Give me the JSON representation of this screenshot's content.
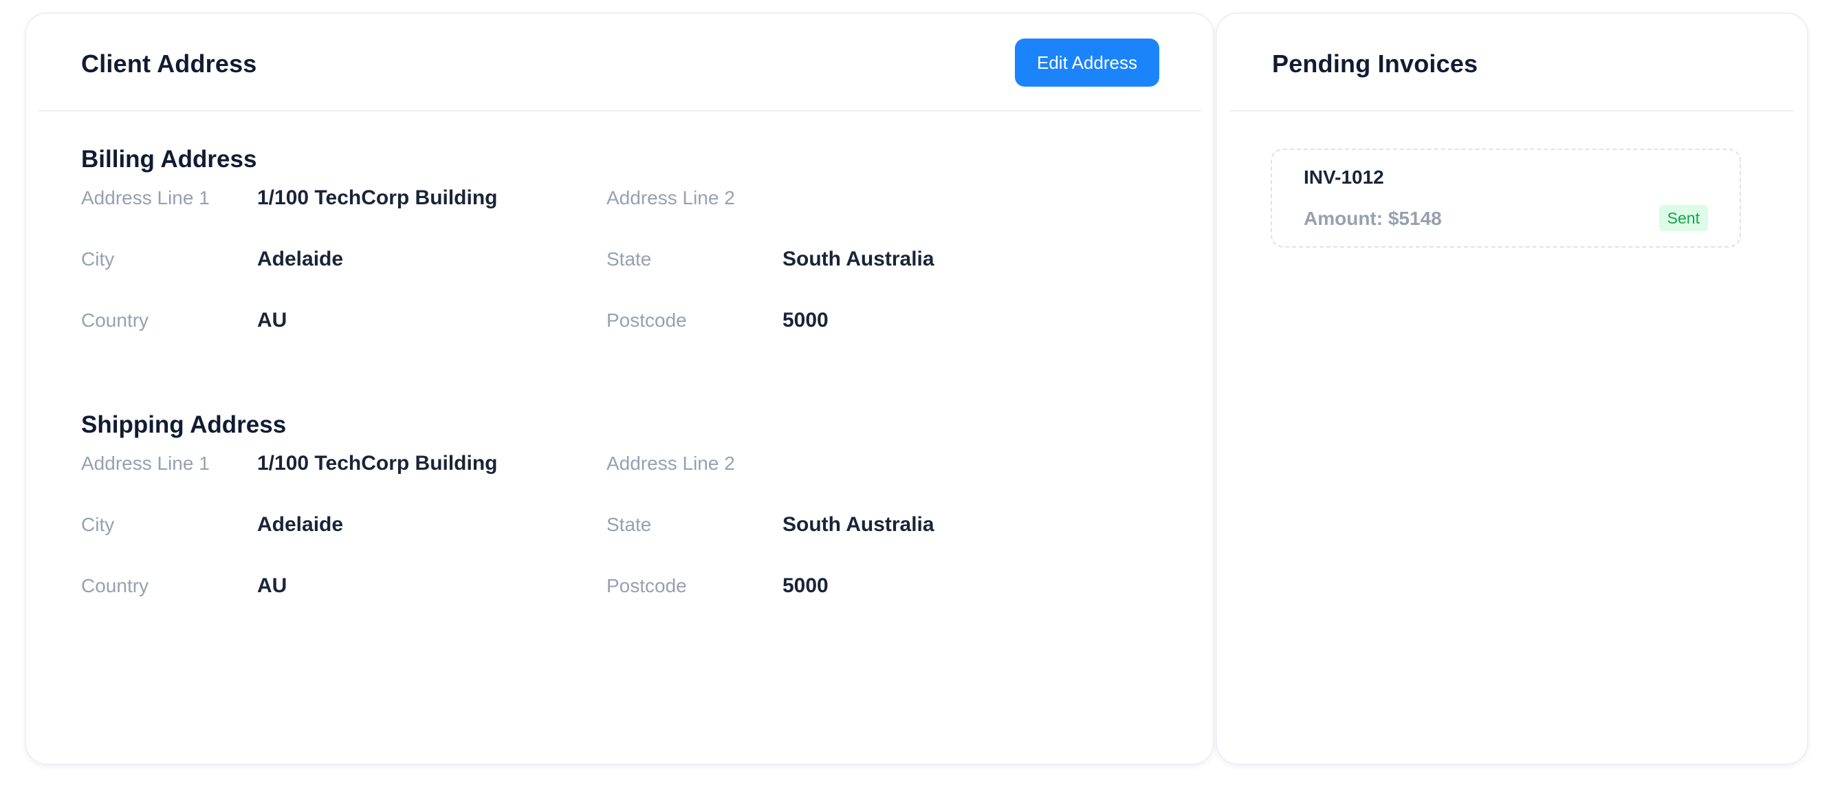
{
  "address_card": {
    "title": "Client Address",
    "edit_button_label": "Edit Address",
    "billing": {
      "title": "Billing Address",
      "fields": [
        {
          "label": "Address Line 1",
          "value": "1/100 TechCorp Building"
        },
        {
          "label": "Address Line 2",
          "value": ""
        },
        {
          "label": "City",
          "value": "Adelaide"
        },
        {
          "label": "State",
          "value": "South Australia"
        },
        {
          "label": "Country",
          "value": "AU"
        },
        {
          "label": "Postcode",
          "value": "5000"
        }
      ]
    },
    "shipping": {
      "title": "Shipping Address",
      "fields": [
        {
          "label": "Address Line 1",
          "value": "1/100 TechCorp Building"
        },
        {
          "label": "Address Line 2",
          "value": ""
        },
        {
          "label": "City",
          "value": "Adelaide"
        },
        {
          "label": "State",
          "value": "South Australia"
        },
        {
          "label": "Country",
          "value": "AU"
        },
        {
          "label": "Postcode",
          "value": "5000"
        }
      ]
    }
  },
  "invoices_card": {
    "title": "Pending Invoices",
    "items": [
      {
        "number": "INV-1012",
        "amount": "Amount: $5148",
        "status": "Sent"
      }
    ]
  },
  "colors": {
    "primary_button": "#1c84fb",
    "status_sent_bg": "#dcfce7",
    "status_sent_text": "#16a34a",
    "muted_text": "#97a0b2",
    "heading_text": "#111c33"
  }
}
